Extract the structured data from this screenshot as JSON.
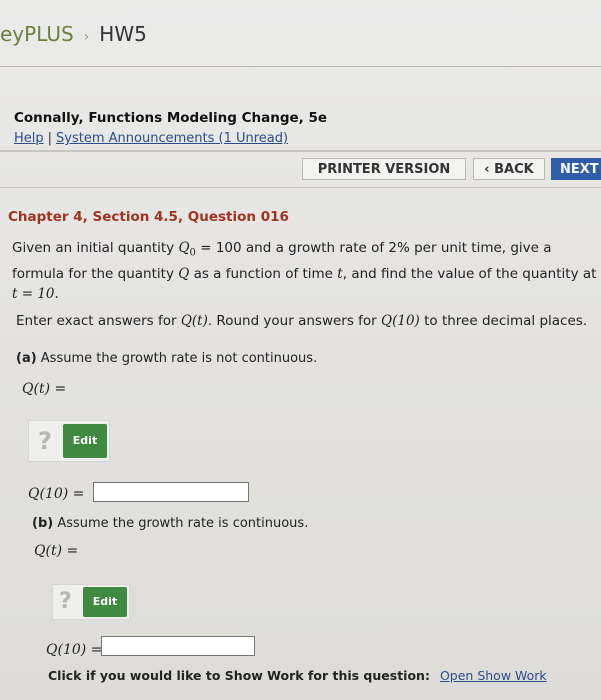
{
  "breadcrumb": {
    "brand": "eyPLUS",
    "separator": "›",
    "current": "HW5"
  },
  "course": {
    "title": "Connally, Functions Modeling Change, 5e",
    "help": "Help",
    "divider": "|",
    "announcements": "System Announcements (1 Unread)"
  },
  "nav": {
    "printer": "PRINTER VERSION",
    "back": "‹ BACK",
    "next": "NEXT"
  },
  "question": {
    "heading": "Chapter 4, Section 4.5, Question 016",
    "t1": "Given an initial quantity ",
    "q0": "Q",
    "q0_sub": "0",
    "t2": " = 100 and a growth rate of 2% per unit time, give a formula for the quantity ",
    "q": "Q",
    "t3": " as a function of time ",
    "t": "t",
    "t4": ", and find the value of the quantity at ",
    "t_eq": "t = 10.",
    "instr_1": "Enter exact answers for ",
    "instr_qt": "Q(t)",
    "instr_2": ". Round your answers for ",
    "instr_q10": "Q(10)",
    "instr_3": " to three decimal places."
  },
  "part_a": {
    "label": "(a)",
    "text": " Assume the growth rate is not continuous.",
    "qt": "Q(t) =",
    "qmark": "?",
    "edit": "Edit",
    "q10": "Q(10) =",
    "q10_value": ""
  },
  "part_b": {
    "label": "(b)",
    "text": " Assume the growth rate is continuous.",
    "qt": "Q(t) =",
    "qmark": "?",
    "edit": "Edit",
    "q10": "Q(10) =",
    "q10_value": ""
  },
  "show_work": {
    "text": "Click if you would like to Show Work for this question:",
    "link": "Open Show Work"
  },
  "colors": {
    "heading": "#a03420",
    "edit_button": "#3f8a40",
    "next_button": "#2f5da8",
    "link": "#2b4d8c"
  }
}
